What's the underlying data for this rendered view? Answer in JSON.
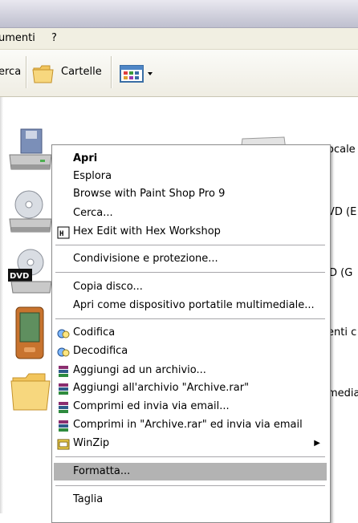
{
  "menubar": {
    "item_tools_partial": "umenti",
    "item_help": "?"
  },
  "toolbar": {
    "search_partial": "erca",
    "folders": "Cartelle"
  },
  "behind": {
    "local_partial": "ocale",
    "dvd_partial": "VD (E",
    "cd_partial": "D (G",
    "device_partial": "enti c",
    "media_partial": "media"
  },
  "menu": {
    "open": "Apri",
    "explore": "Esplora",
    "browse_psp": "Browse with Paint Shop Pro 9",
    "search": "Cerca...",
    "hex_edit": "Hex Edit with Hex Workshop",
    "sharing": "Condivisione e protezione...",
    "copy_disk": "Copia disco...",
    "open_portable": "Apri come dispositivo portatile multimediale...",
    "encode": "Codifica",
    "decode": "Decodifica",
    "add_archive": "Aggiungi ad un archivio...",
    "add_archive_rar": "Aggiungi all'archivio \"Archive.rar\"",
    "compress_email": "Comprimi ed invia via email...",
    "compress_rar_email": "Comprimi in \"Archive.rar\" ed invia via email",
    "winzip": "WinZip",
    "format": "Formatta...",
    "cut_partial": "Taglia"
  },
  "colors": {
    "selected_bg": "#b3b3b3",
    "menu_bg": "#ffffff",
    "toolbar_bg": "#efede3"
  }
}
